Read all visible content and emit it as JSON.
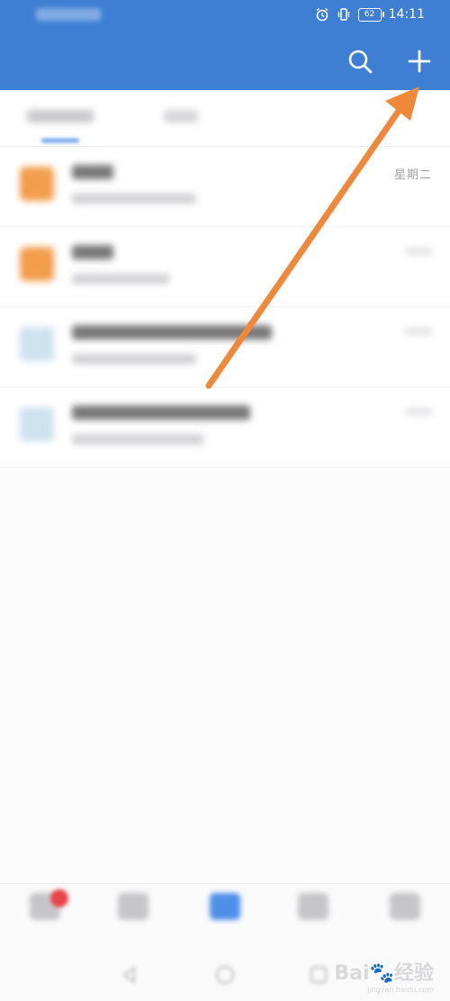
{
  "status_bar": {
    "battery": "62",
    "time": "14:11"
  },
  "header": {
    "title": "",
    "search_icon": "search-icon",
    "add_icon": "plus-icon"
  },
  "tabs": [
    {
      "label": ""
    },
    {
      "label": ""
    }
  ],
  "list": [
    {
      "title": "",
      "subtitle": "",
      "time": "星期二",
      "icon": "orange-doc-icon"
    },
    {
      "title": "",
      "subtitle": "",
      "time": "",
      "icon": "orange-doc-icon"
    },
    {
      "title": "",
      "subtitle": "",
      "time": "",
      "icon": "image-icon"
    },
    {
      "title": "",
      "subtitle": "",
      "time": "",
      "icon": "image-icon"
    }
  ],
  "bottom_nav": [
    {
      "label": ""
    },
    {
      "label": ""
    },
    {
      "label": ""
    },
    {
      "label": ""
    },
    {
      "label": ""
    }
  ],
  "watermark": {
    "brand": "Bai",
    "suffix": "经验",
    "url": "jingyan.baidu.com"
  },
  "colors": {
    "header": "#3e7fd4",
    "accent": "#4e8fe8",
    "annotation_arrow": "#f0883a"
  }
}
